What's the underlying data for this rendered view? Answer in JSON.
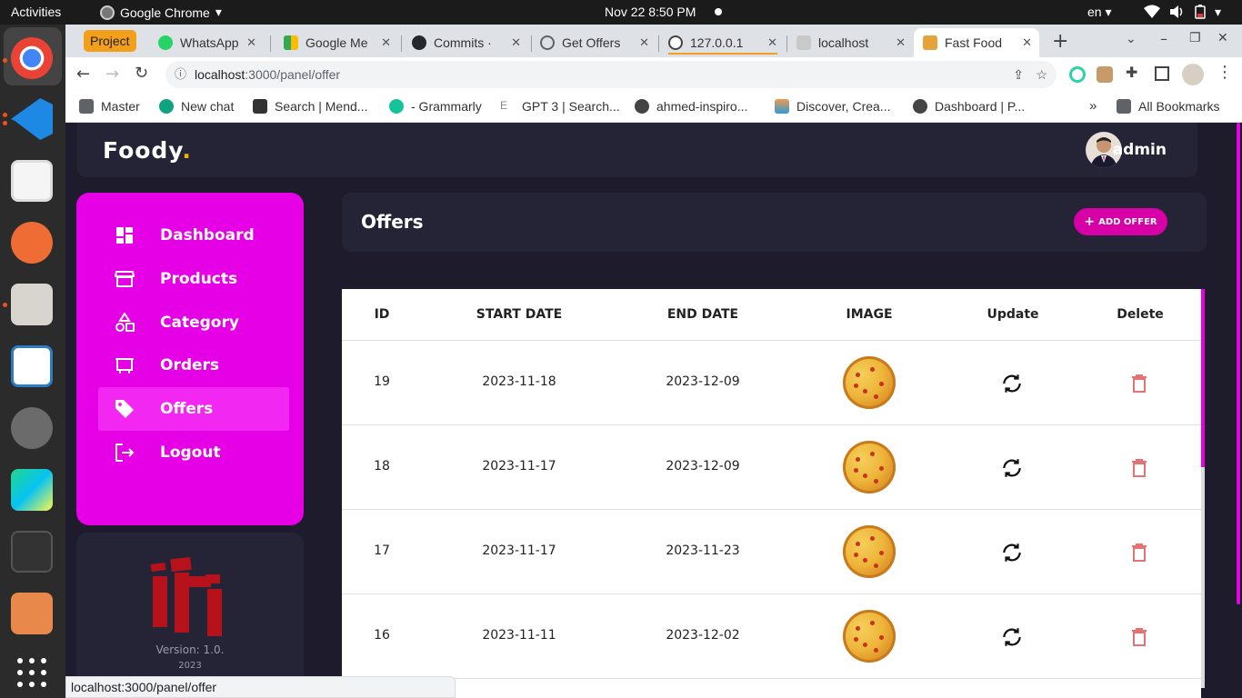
{
  "system": {
    "activities": "Activities",
    "app_name": "Google Chrome",
    "clock": "Nov 22  8:50 PM",
    "language": "en"
  },
  "browser": {
    "tab_group_label": "Project",
    "tabs": [
      {
        "label": "WhatsApp",
        "favicon_color": "#25d366"
      },
      {
        "label": "Google Me",
        "favicon_color": "#34a853"
      },
      {
        "label": "Commits ·",
        "favicon_color": "#24292e"
      },
      {
        "label": "Get Offers",
        "favicon_color": "#5f6368"
      },
      {
        "label": "127.0.0.1",
        "favicon_color": "#5f6368"
      },
      {
        "label": "localhost",
        "favicon_color": "#8a8a8a"
      },
      {
        "label": "Fast Food",
        "favicon_color": "#e5a33a"
      }
    ],
    "url_host": "localhost",
    "url_path": ":3000/panel/offer",
    "bookmarks": [
      {
        "label": "Master"
      },
      {
        "label": "New chat"
      },
      {
        "label": "Search | Mend..."
      },
      {
        "label": "- Grammarly"
      },
      {
        "label": "GPT 3 | Search..."
      },
      {
        "label": "ahmed-inspiro..."
      },
      {
        "label": "Discover, Crea..."
      },
      {
        "label": "Dashboard | P..."
      }
    ],
    "all_bookmarks": "All Bookmarks",
    "status_url": "localhost:3000/panel/offer"
  },
  "header": {
    "logo": "Foody",
    "logo_dot": ".",
    "user_name": "admin"
  },
  "sidebar": {
    "items": [
      {
        "label": "Dashboard"
      },
      {
        "label": "Products"
      },
      {
        "label": "Category"
      },
      {
        "label": "Orders"
      },
      {
        "label": "Offers"
      },
      {
        "label": "Logout"
      }
    ],
    "selected": "Offers",
    "version": "Version: 1.0.",
    "year": "2023"
  },
  "main": {
    "title": "Offers",
    "add_button": "ADD OFFER",
    "columns": [
      "ID",
      "START DATE",
      "END DATE",
      "IMAGE",
      "Update",
      "Delete"
    ],
    "rows": [
      {
        "id": "19",
        "start": "2023-11-18",
        "end": "2023-12-09"
      },
      {
        "id": "18",
        "start": "2023-11-17",
        "end": "2023-12-09"
      },
      {
        "id": "17",
        "start": "2023-11-17",
        "end": "2023-11-23"
      },
      {
        "id": "16",
        "start": "2023-11-11",
        "end": "2023-12-02"
      }
    ]
  },
  "colors": {
    "accent": "#e600e6",
    "background": "#1e1c2c",
    "card": "#252336",
    "delete": "#e57373"
  }
}
